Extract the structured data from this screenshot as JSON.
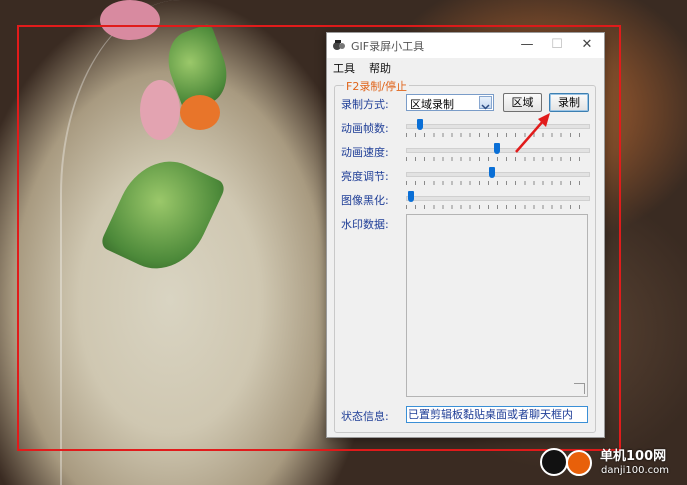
{
  "window": {
    "title": "GIF录屏小工具",
    "controls": {
      "minimize": "—",
      "maximize": "☐",
      "close": "✕"
    }
  },
  "menu": [
    "工具",
    "帮助"
  ],
  "group_title": "F2录制/停止",
  "record_mode": {
    "label": "录制方式:",
    "value": "区域录制",
    "region_button": "区域",
    "record_button": "录制"
  },
  "sliders": [
    {
      "label": "动画帧数:",
      "position_pct": 6
    },
    {
      "label": "动画速度:",
      "position_pct": 50
    },
    {
      "label": "亮度调节:",
      "position_pct": 47
    },
    {
      "label": "图像黑化:",
      "position_pct": 1
    }
  ],
  "watermark_label": "水印数据:",
  "status": {
    "label": "状态信息:",
    "value": "已置剪辑板黏贴桌面或者聊天框内"
  },
  "site_watermark": {
    "name": "单机100网",
    "url": "danji100.com"
  },
  "colors": {
    "accent": "#1f3e97",
    "group_title": "#e0641a",
    "capture_frame": "#e11b1b",
    "thumb": "#0a6fd6"
  }
}
